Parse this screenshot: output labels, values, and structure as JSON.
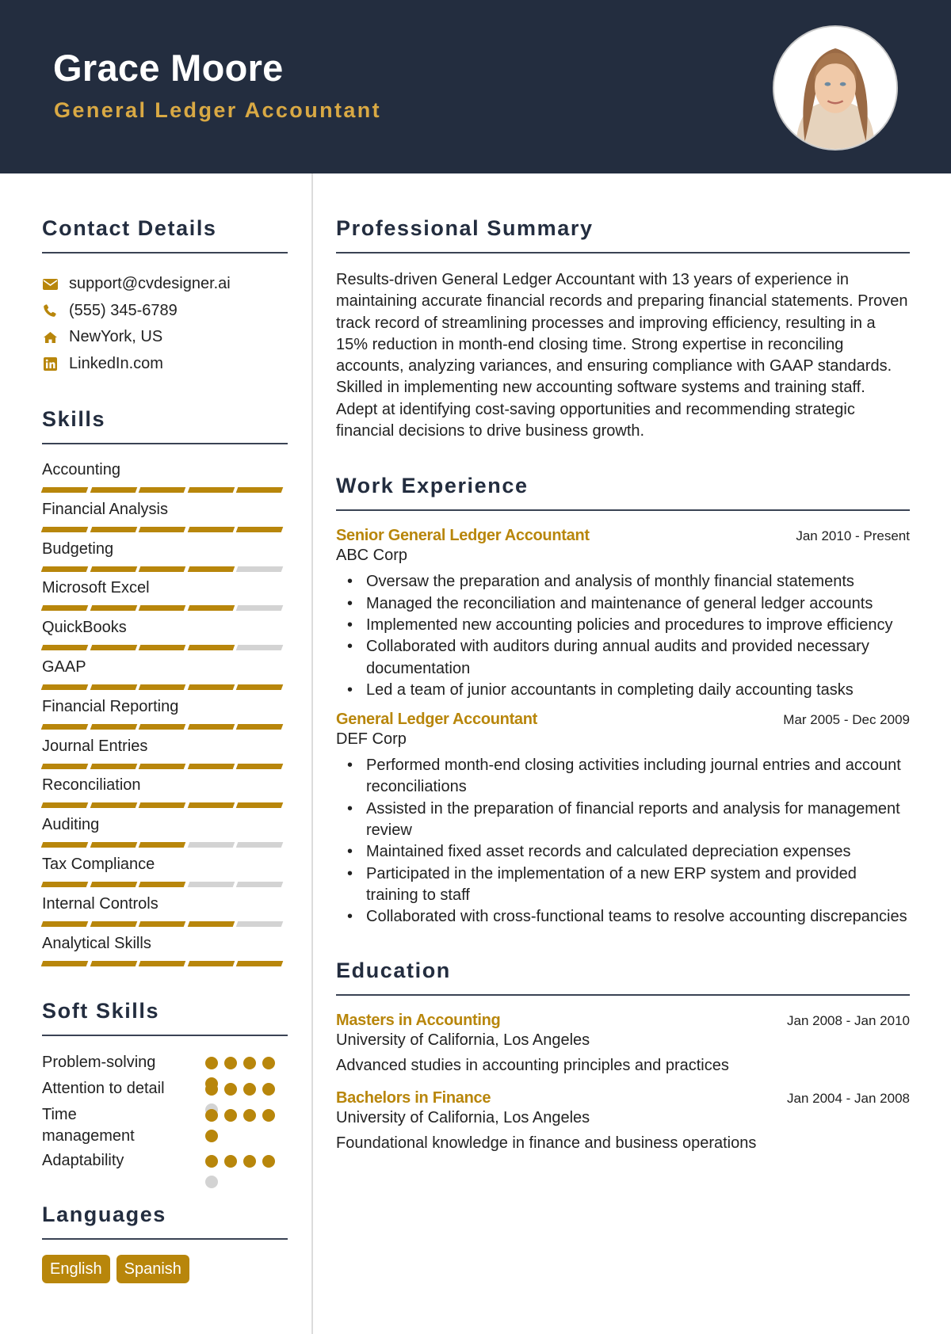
{
  "header": {
    "name": "Grace Moore",
    "title": "General Ledger Accountant",
    "photo_alt": "profile-photo"
  },
  "colors": {
    "header_bg": "#232d3f",
    "accent": "#b8860b",
    "title_gold": "#d9a944",
    "inactive": "#d3d3d3"
  },
  "contact": {
    "heading": "Contact Details",
    "items": [
      {
        "icon": "envelope-icon",
        "text": "support@cvdesigner.ai"
      },
      {
        "icon": "phone-icon",
        "text": "(555) 345-6789"
      },
      {
        "icon": "home-icon",
        "text": "NewYork, US"
      },
      {
        "icon": "linkedin-icon",
        "text": "LinkedIn.com"
      }
    ]
  },
  "skills": {
    "heading": "Skills",
    "max": 5,
    "items": [
      {
        "name": "Accounting",
        "level": 5
      },
      {
        "name": "Financial Analysis",
        "level": 5
      },
      {
        "name": "Budgeting",
        "level": 4
      },
      {
        "name": "Microsoft Excel",
        "level": 4
      },
      {
        "name": "QuickBooks",
        "level": 4
      },
      {
        "name": "GAAP",
        "level": 5
      },
      {
        "name": "Financial Reporting",
        "level": 5
      },
      {
        "name": "Journal Entries",
        "level": 5
      },
      {
        "name": "Reconciliation",
        "level": 5
      },
      {
        "name": "Auditing",
        "level": 3
      },
      {
        "name": "Tax Compliance",
        "level": 3
      },
      {
        "name": "Internal Controls",
        "level": 4
      },
      {
        "name": "Analytical Skills",
        "level": 5
      }
    ]
  },
  "soft_skills": {
    "heading": "Soft Skills",
    "max": 5,
    "items": [
      {
        "name": "Problem-solving",
        "level": 5
      },
      {
        "name": "Attention to detail",
        "level": 4
      },
      {
        "name": "Time management",
        "level": 5
      },
      {
        "name": "Adaptability",
        "level": 4
      }
    ]
  },
  "languages": {
    "heading": "Languages",
    "items": [
      "English",
      "Spanish"
    ]
  },
  "summary": {
    "heading": "Professional Summary",
    "text": "Results-driven General Ledger Accountant with 13 years of experience in maintaining accurate financial records and preparing financial statements. Proven track record of streamlining processes and improving efficiency, resulting in a 15% reduction in month-end closing time. Strong expertise in reconciling accounts, analyzing variances, and ensuring compliance with GAAP standards. Skilled in implementing new accounting software systems and training staff. Adept at identifying cost-saving opportunities and recommending strategic financial decisions to drive business growth."
  },
  "experience": {
    "heading": "Work Experience",
    "items": [
      {
        "role": "Senior General Ledger Accountant",
        "company": "ABC Corp",
        "dates": "Jan 2010 - Present",
        "bullets": [
          "Oversaw the preparation and analysis of monthly financial statements",
          "Managed the reconciliation and maintenance of general ledger accounts",
          "Implemented new accounting policies and procedures to improve efficiency",
          "Collaborated with auditors during annual audits and provided necessary documentation",
          "Led a team of junior accountants in completing daily accounting tasks"
        ]
      },
      {
        "role": "General Ledger Accountant",
        "company": "DEF Corp",
        "dates": "Mar 2005 - Dec 2009",
        "bullets": [
          "Performed month-end closing activities including journal entries and account reconciliations",
          "Assisted in the preparation of financial reports and analysis for management review",
          "Maintained fixed asset records and calculated depreciation expenses",
          "Participated in the implementation of a new ERP system and provided training to staff",
          "Collaborated with cross-functional teams to resolve accounting discrepancies"
        ]
      }
    ]
  },
  "education": {
    "heading": "Education",
    "items": [
      {
        "degree": "Masters in Accounting",
        "school": "University of California, Los Angeles",
        "dates": "Jan 2008 - Jan 2010",
        "description": "Advanced studies in accounting principles and practices"
      },
      {
        "degree": "Bachelors in Finance",
        "school": "University of California, Los Angeles",
        "dates": "Jan 2004 - Jan 2008",
        "description": "Foundational knowledge in finance and business operations"
      }
    ]
  }
}
